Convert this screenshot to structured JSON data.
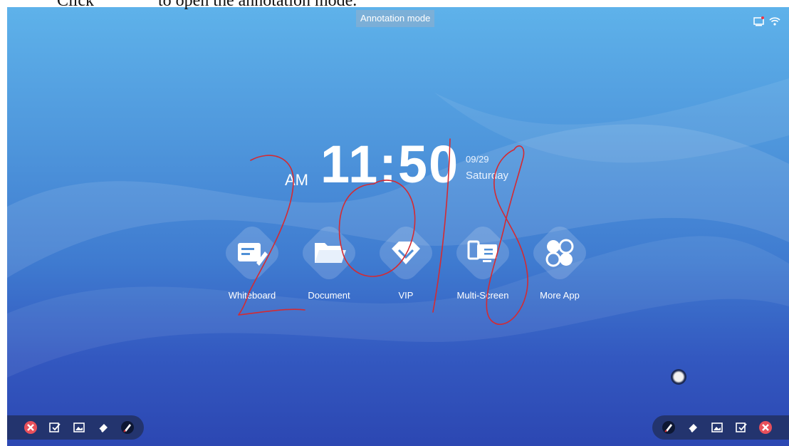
{
  "caption": {
    "before": "Click",
    "after": "to open the annotation mode."
  },
  "mode_label": "Annotation mode",
  "clock": {
    "ampm": "AM",
    "time": "11:50",
    "date": "09/29",
    "day": "Saturday"
  },
  "apps": [
    {
      "label": "Whiteboard",
      "icon": "whiteboard-icon"
    },
    {
      "label": "Document",
      "icon": "folder-icon"
    },
    {
      "label": "VIP",
      "icon": "vip-icon"
    },
    {
      "label": "Multi-Screen",
      "icon": "multi-screen-icon"
    },
    {
      "label": "More App",
      "icon": "more-app-icon"
    }
  ],
  "toolbar_left": [
    "close-icon",
    "select-icon",
    "image-icon",
    "eraser-icon",
    "pen-icon"
  ],
  "toolbar_right": [
    "pen-icon",
    "eraser-icon",
    "image-icon",
    "select-icon",
    "close-icon"
  ],
  "colors": {
    "ink": "#d42a32",
    "toolbar": "#23346e",
    "close": "#e8505b"
  }
}
